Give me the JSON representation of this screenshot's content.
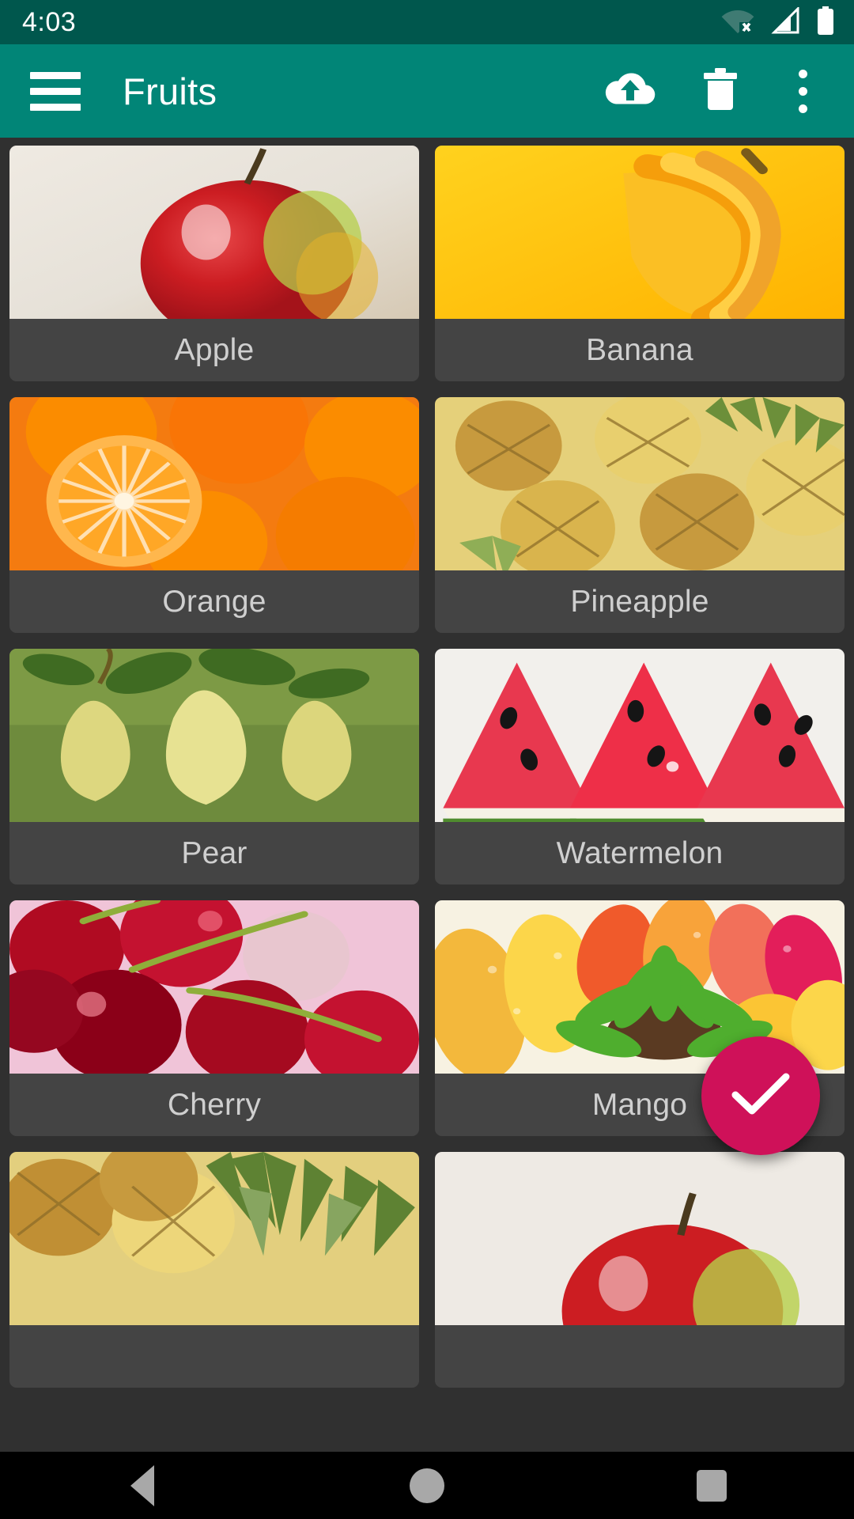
{
  "status_bar": {
    "clock": "4:03",
    "background": "#00574d",
    "icons": [
      {
        "name": "wifi-off-icon",
        "label": "wifi-disconnected"
      },
      {
        "name": "cellular-signal-icon",
        "label": "signal"
      },
      {
        "name": "battery-full-icon",
        "label": "battery"
      }
    ]
  },
  "app_bar": {
    "background": "#018577",
    "title": "Fruits",
    "menu_icon": "hamburger-menu-icon",
    "actions": [
      {
        "name": "upload-button",
        "icon": "cloud-upload-icon",
        "label": "Upload"
      },
      {
        "name": "delete-button",
        "icon": "trash-icon",
        "label": "Delete"
      },
      {
        "name": "overflow-button",
        "icon": "more-vert-icon",
        "label": "More options"
      }
    ]
  },
  "grid": {
    "columns": 2,
    "background": "#303030",
    "card_background": "#444444",
    "label_color": "#cfcfcf",
    "items": [
      {
        "label": "Apple",
        "image": "apple-photo"
      },
      {
        "label": "Banana",
        "image": "banana-photo"
      },
      {
        "label": "Orange",
        "image": "orange-photo"
      },
      {
        "label": "Pineapple",
        "image": "pineapple-photo"
      },
      {
        "label": "Pear",
        "image": "pear-photo"
      },
      {
        "label": "Watermelon",
        "image": "watermelon-photo"
      },
      {
        "label": "Cherry",
        "image": "cherry-photo"
      },
      {
        "label": "Mango",
        "image": "mango-photo"
      },
      {
        "label": "",
        "image": "pineapple-photo"
      },
      {
        "label": "",
        "image": "apple-photo"
      }
    ]
  },
  "fab": {
    "name": "confirm-fab",
    "icon": "check-icon",
    "label": "Confirm",
    "color": "#cf1159"
  },
  "nav_bar": {
    "background": "#000000",
    "buttons": [
      {
        "name": "nav-back-button",
        "icon": "triangle-back-icon",
        "label": "Back"
      },
      {
        "name": "nav-home-button",
        "icon": "circle-home-icon",
        "label": "Home"
      },
      {
        "name": "nav-recents-button",
        "icon": "square-recents-icon",
        "label": "Recents"
      }
    ]
  }
}
